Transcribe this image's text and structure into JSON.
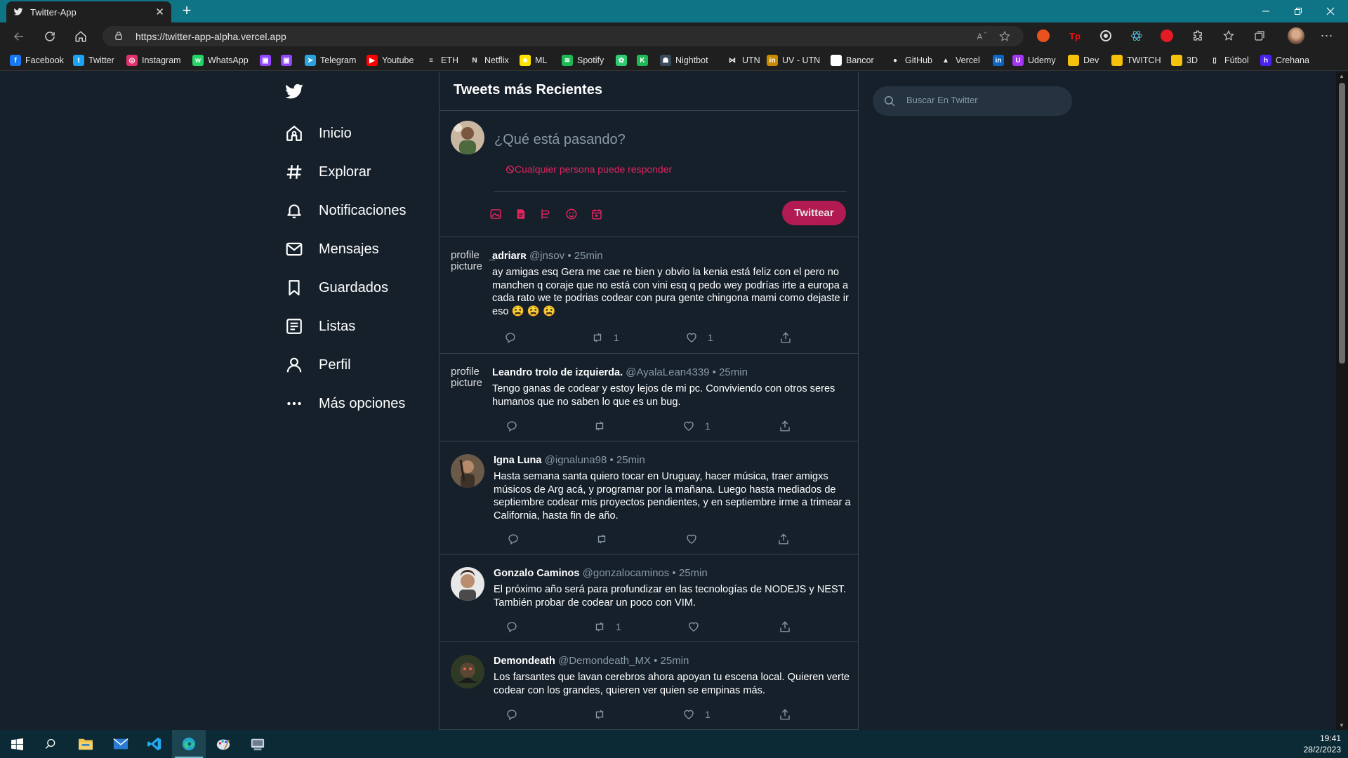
{
  "browser": {
    "tab_title": "Twitter-App",
    "url": "https://twitter-app-alpha.vercel.app",
    "bookmarks": [
      {
        "label": "Facebook",
        "color": "#1877f2",
        "glyph": "f"
      },
      {
        "label": "Twitter",
        "color": "#1da1f2",
        "glyph": "t"
      },
      {
        "label": "Instagram",
        "color": "#e1306c",
        "glyph": "◎"
      },
      {
        "label": "WhatsApp",
        "color": "#25d366",
        "glyph": "w"
      },
      {
        "label": "",
        "color": "#9146ff",
        "glyph": "▣"
      },
      {
        "label": "",
        "color": "#9146ff",
        "glyph": "▣"
      },
      {
        "label": "Telegram",
        "color": "#2aa3df",
        "glyph": "➤"
      },
      {
        "label": "Youtube",
        "color": "#ff0000",
        "glyph": "▶"
      },
      {
        "label": "ETH",
        "color": "#1f1f1f",
        "glyph": "≡"
      },
      {
        "label": "Netflix",
        "color": "#1f1f1f",
        "glyph": "N"
      },
      {
        "label": "ML",
        "color": "#ffe600",
        "glyph": "☻"
      },
      {
        "label": "Spotify",
        "color": "#1db954",
        "glyph": "≋"
      },
      {
        "label": "",
        "color": "#2ecc71",
        "glyph": "✿"
      },
      {
        "label": "",
        "color": "#1db954",
        "glyph": "K"
      },
      {
        "label": "Nightbot",
        "color": "#3a4a5a",
        "glyph": "☗"
      },
      {
        "label": "UTN",
        "color": "#1f1f1f",
        "glyph": "⋈"
      },
      {
        "label": "UV - UTN",
        "color": "#c98a00",
        "glyph": "in"
      },
      {
        "label": "Bancor",
        "color": "#ffffff",
        "glyph": "◉"
      },
      {
        "label": "GitHub",
        "color": "#1f1f1f",
        "glyph": "●"
      },
      {
        "label": "Vercel",
        "color": "#1f1f1f",
        "glyph": "▲"
      },
      {
        "label": "",
        "color": "#0a66c2",
        "glyph": "in"
      },
      {
        "label": "Udemy",
        "color": "#a435f0",
        "glyph": "U"
      },
      {
        "label": "Dev",
        "color": "#f4c20d",
        "glyph": ""
      },
      {
        "label": "TWITCH",
        "color": "#f4c20d",
        "glyph": ""
      },
      {
        "label": "3D",
        "color": "#f4c20d",
        "glyph": ""
      },
      {
        "label": "Fútbol",
        "color": "#1f1f1f",
        "glyph": "▯"
      },
      {
        "label": "Crehana",
        "color": "#4b22f4",
        "glyph": "h"
      }
    ]
  },
  "nav": {
    "items": [
      {
        "label": "Inicio",
        "icon": "home-icon"
      },
      {
        "label": "Explorar",
        "icon": "hashtag-icon"
      },
      {
        "label": "Notificaciones",
        "icon": "bell-icon"
      },
      {
        "label": "Mensajes",
        "icon": "mail-icon"
      },
      {
        "label": "Guardados",
        "icon": "bookmark-icon"
      },
      {
        "label": "Listas",
        "icon": "list-icon"
      },
      {
        "label": "Perfil",
        "icon": "user-icon"
      },
      {
        "label": "Más opciones",
        "icon": "more-icon"
      }
    ]
  },
  "feed": {
    "title": "Tweets más Recientes",
    "composer": {
      "placeholder": "¿Qué está pasando?",
      "reply_setting": "Cualquier persona puede responder",
      "tweet_button": "Twittear"
    },
    "tweets": [
      {
        "name": "̲adriarʀ",
        "meta": "@jnsov • 25min",
        "avatar_alt": "profile picture",
        "text": "ay amigas esq Gera me cae re bien y obvio la kenia está feliz con el pero no manchen q coraje que no está con vini esq q pedo wey podrías irte a europa a cada rato we te podrias codear con pura gente chingona mami como dejaste ir eso 😫 😫 😫",
        "retweets": "1",
        "likes": "1"
      },
      {
        "name": "Leandro trolo de izquierda.",
        "meta": "@AyalaLean4339 • 25min",
        "avatar_alt": "profile picture",
        "text": "Tengo ganas de codear y estoy lejos de mi pc. Conviviendo con otros seres humanos que no saben lo que es un bug.",
        "retweets": "",
        "likes": "1"
      },
      {
        "name": "Igna Luna",
        "meta": "@ignaluna98 • 25min",
        "avatar_alt": "",
        "text": "Hasta semana santa quiero tocar en Uruguay, hacer música, traer amigxs músicos de Arg acá, y programar por la mañana. Luego hasta mediados de septiembre codear mis proyectos pendientes, y en septiembre irme a trimear a California, hasta fin de año.",
        "retweets": "",
        "likes": ""
      },
      {
        "name": "Gonzalo Caminos",
        "meta": "@gonzalocaminos • 25min",
        "avatar_alt": "",
        "text": "El próximo año será para profundizar en las tecnologías de NODEJS y NEST. También probar de codear un poco con VIM.",
        "retweets": "1",
        "likes": ""
      },
      {
        "name": "Demondeath",
        "meta": "@Demondeath_MX • 25min",
        "avatar_alt": "",
        "text": "Los farsantes que lavan cerebros ahora apoyan tu escena local. Quieren verte codear con los grandes, quieren ver quien se empinas más.",
        "retweets": "",
        "likes": "1"
      }
    ]
  },
  "search": {
    "placeholder": "Buscar En Twitter"
  },
  "taskbar": {
    "time": "19:41",
    "date": "28/2/2023"
  },
  "colors": {
    "background": "#15202b",
    "accent": "#e0245e",
    "tweet_button": "#b21a52",
    "titlebar": "#0e7486"
  }
}
